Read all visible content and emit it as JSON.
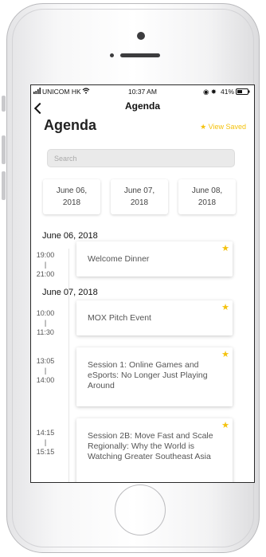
{
  "status_bar": {
    "carrier": "UNICOM HK",
    "time": "10:37 AM",
    "battery": "41%"
  },
  "nav": {
    "title": "Agenda"
  },
  "header": {
    "title": "Agenda",
    "view_saved": "★ View Saved"
  },
  "search": {
    "placeholder": "Search"
  },
  "date_tabs": [
    {
      "line1": "June 06,",
      "line2": "2018"
    },
    {
      "line1": "June 07,",
      "line2": "2018"
    },
    {
      "line1": "June 08,",
      "line2": "2018"
    }
  ],
  "sections": [
    {
      "date": "June 06, 2018",
      "events": [
        {
          "start": "19:00",
          "sep": "|",
          "end": "21:00",
          "title": "Welcome Dinner"
        }
      ]
    },
    {
      "date": "June 07, 2018",
      "events": [
        {
          "start": "10:00",
          "sep": "|",
          "end": "11:30",
          "title": "MOX Pitch Event"
        },
        {
          "start": "13:05",
          "sep": "|",
          "end": "14:00",
          "title": "Session 1: Online Games and eSports: No Longer Just Playing Around"
        },
        {
          "start": "14:15",
          "sep": "|",
          "end": "15:15",
          "title": "Session 2B: Move Fast and Scale Regionally: Why the World is Watching Greater Southeast Asia"
        }
      ]
    }
  ],
  "icons": {
    "star": "star-icon",
    "back": "back-chevron-icon",
    "wifi": "wifi-icon",
    "battery": "battery-icon"
  },
  "colors": {
    "accent": "#f4c20d",
    "text": "#555555"
  }
}
